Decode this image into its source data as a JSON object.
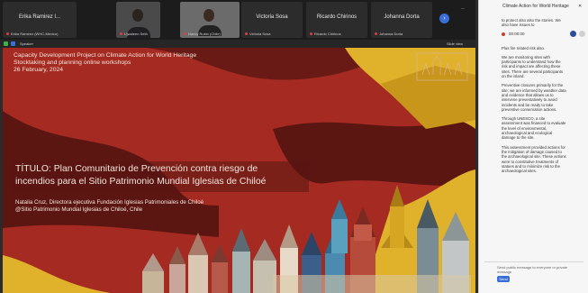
{
  "participants": [
    {
      "name": "Erika Ramirez I...",
      "sub": "Erika Ramirez (WHC-Mexico)",
      "type": "name"
    },
    {
      "name": "",
      "sub": "Ujwaleen Seth",
      "type": "video1"
    },
    {
      "name": "",
      "sub": "Nancy Rubio (Chile)",
      "type": "video2"
    },
    {
      "name": "Victoria Sosa",
      "sub": "Victoria Sosa",
      "type": "name"
    },
    {
      "name": "Ricardo Chirinos",
      "sub": "Ricardo Chirinos",
      "type": "name"
    },
    {
      "name": "Johanna Dorta",
      "sub": "Johanna Dorta",
      "type": "name"
    }
  ],
  "toolbar": {
    "left_label": "Speaker",
    "right_label": "Slide view"
  },
  "slide": {
    "header_line1": "Capacity Development Project on Climate Action for World Heritage",
    "header_line2": "Stocktaking and planning online workshops",
    "header_line3": "26 February, 2024",
    "title_line1": "TÍTULO: Plan Comunitario de Prevención contra riesgo de",
    "title_line2": "incendios para el Sitio Patrimonio Mundial Iglesias de Chiloé",
    "author_line1": "Natalia Cruz, Directora ejecutiva Fundación Iglesias Patrimoniales de Chiloé",
    "author_line2": "@Sitio Patrimonio Mundial Iglesias de Chiloé, Chile"
  },
  "colors": {
    "slide_red": "#a52a22",
    "slide_dark": "#5c1612",
    "slide_yellow": "#e0b12a"
  },
  "chat": {
    "title": "Climate Action for World Heritage",
    "messages": [
      "to protect also also the stories. We also have issues to",
      "Plus fire related risk also.",
      "We are monitoring sites with participants to understand how the risk and impact are affecting these sites. There are several participants on the island.",
      "Preventive closures primarily for the site; we are informed by weather data and evidence that allows us to intervene preventatively to avoid incidents and be ready to take preventive conservation actions.",
      "Through UNESCO, a site assessment was financed to evaluate the level of environmental, archaeological and ecological damage to the site.",
      "This assessment provided actions for the mitigation of damage caused to the archaeological site. These actions were to constitutive treatments of statues and to minimize risk to the archaeological sites."
    ],
    "rec_label": "00:00:00",
    "input_placeholder": "Send public message to everyone or private message",
    "send_label": "Send"
  }
}
